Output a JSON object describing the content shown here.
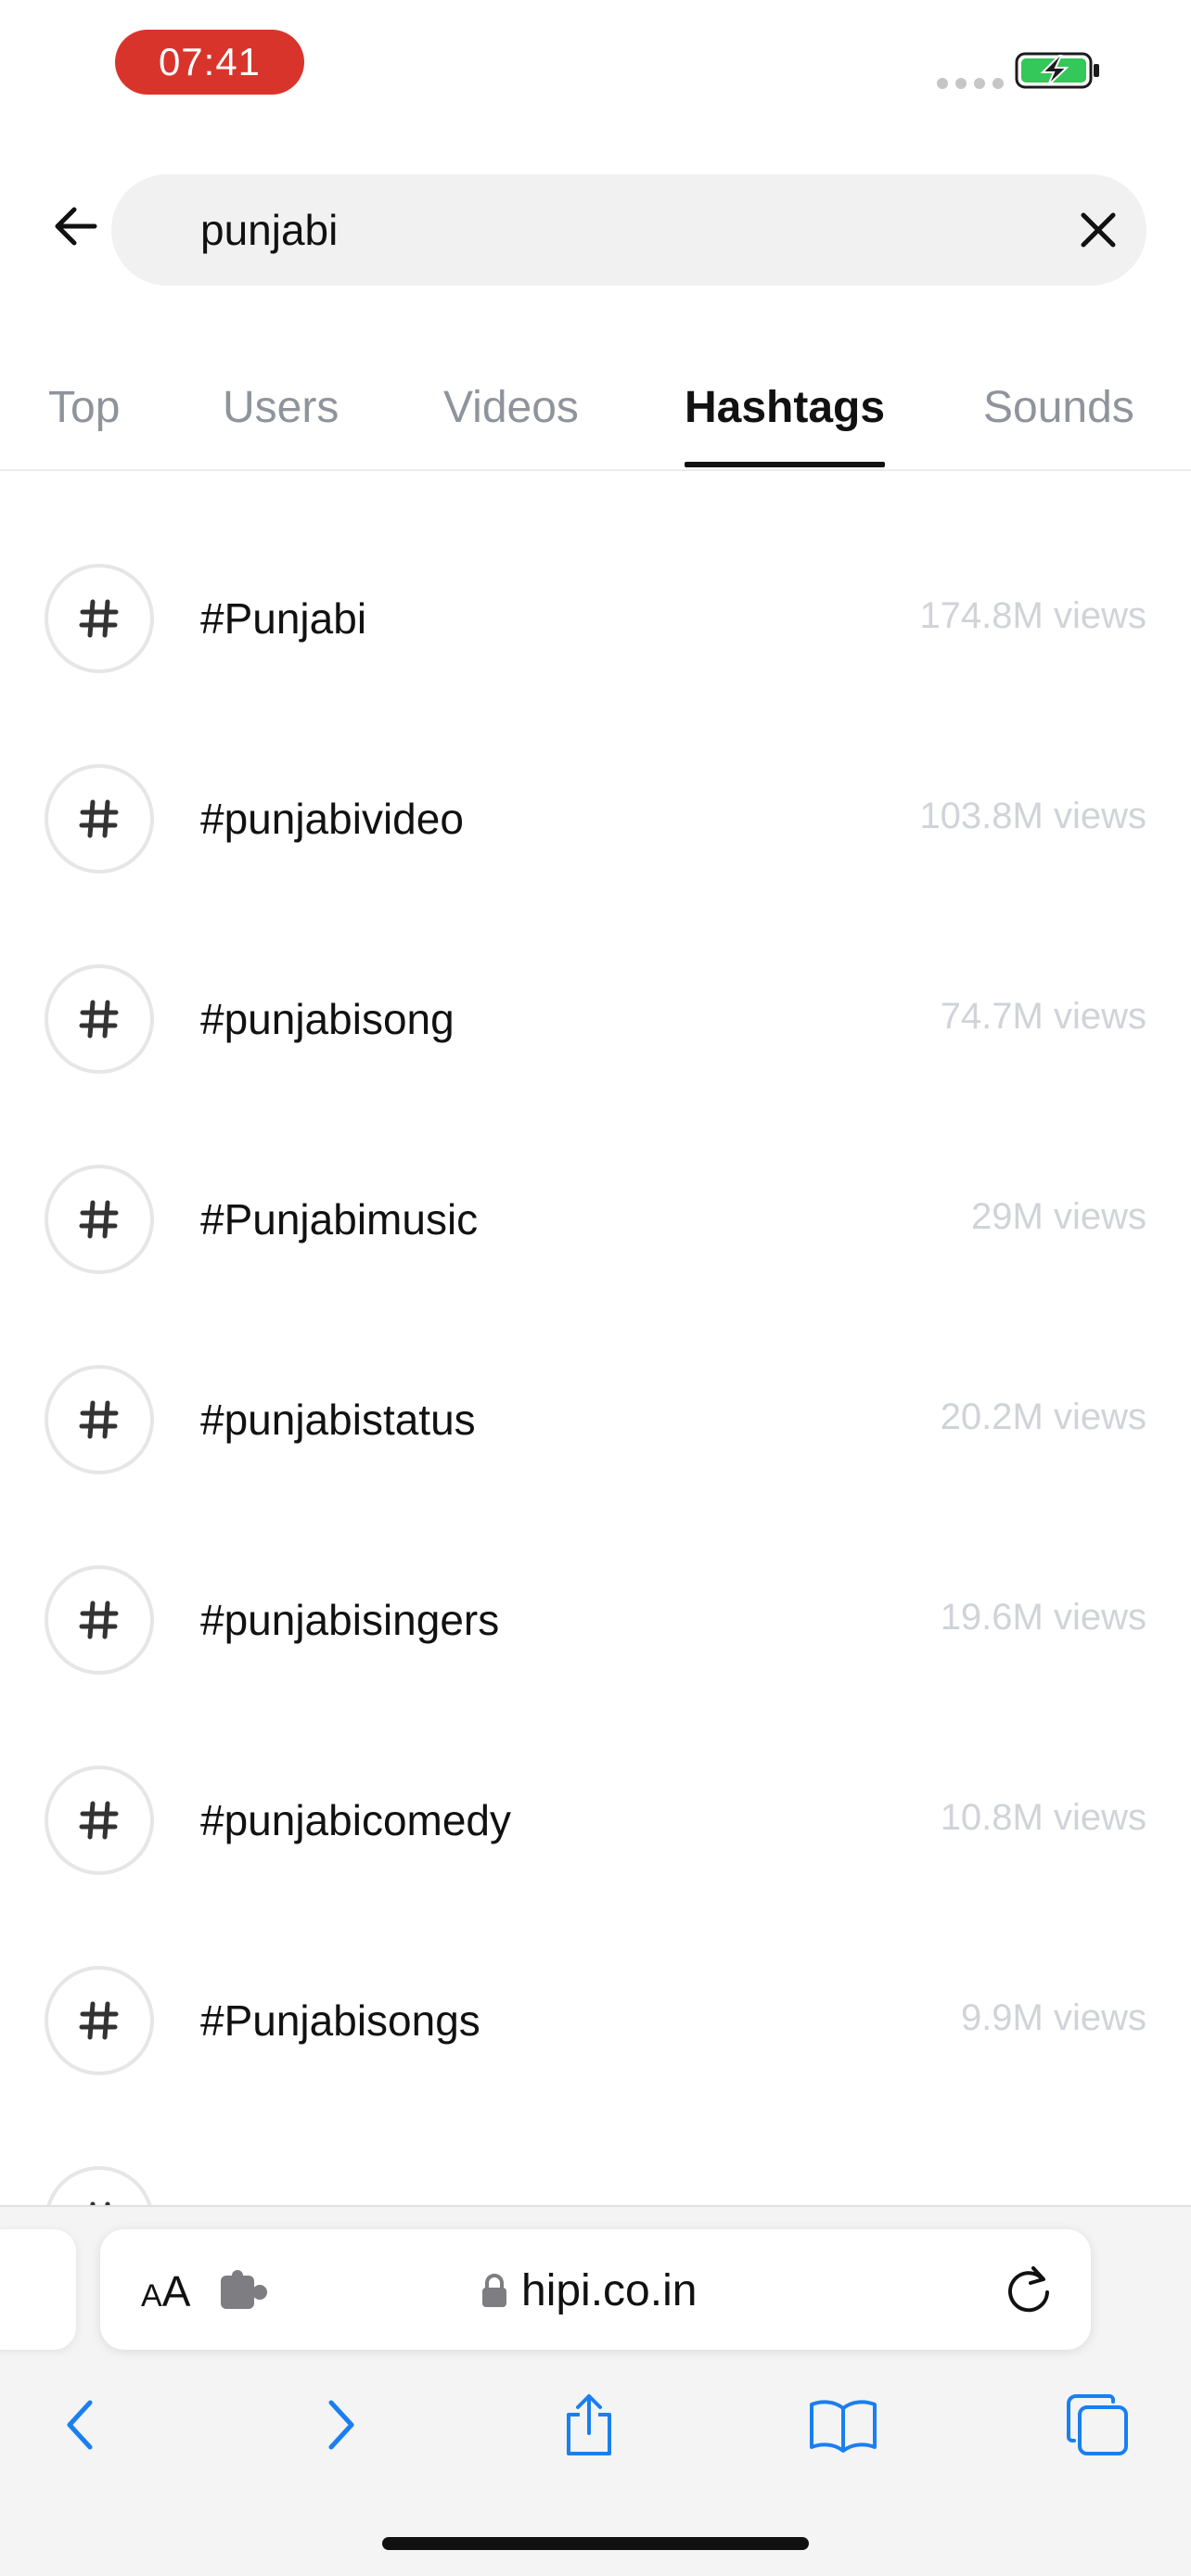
{
  "status_bar": {
    "time": "07:41",
    "battery_state": "charging",
    "battery_color": "#34c759",
    "time_pill_color": "#d9342b"
  },
  "search": {
    "query": "punjabi",
    "back_icon": "arrow-left-icon",
    "clear_icon": "close-icon"
  },
  "tabs": [
    {
      "label": "Top",
      "active": false
    },
    {
      "label": "Users",
      "active": false
    },
    {
      "label": "Videos",
      "active": false
    },
    {
      "label": "Hashtags",
      "active": true
    },
    {
      "label": "Sounds",
      "active": false
    }
  ],
  "hashtags": [
    {
      "name": "#Punjabi",
      "views": "174.8M views"
    },
    {
      "name": "#punjabivideo",
      "views": "103.8M views"
    },
    {
      "name": "#punjabisong",
      "views": "74.7M views"
    },
    {
      "name": "#Punjabimusic",
      "views": "29M views"
    },
    {
      "name": "#punjabistatus",
      "views": "20.2M views"
    },
    {
      "name": "#punjabisingers",
      "views": "19.6M views"
    },
    {
      "name": "#punjabicomedy",
      "views": "10.8M views"
    },
    {
      "name": "#Punjabisongs",
      "views": "9.9M views"
    }
  ],
  "browser": {
    "aa_small": "A",
    "aa_big": "A",
    "url": "hipi.co.in",
    "accent_color": "#1a7ff0",
    "icons": {
      "extension": "puzzle-icon",
      "lock": "lock-icon",
      "reload": "reload-icon",
      "back": "chevron-left-icon",
      "forward": "chevron-right-icon",
      "share": "share-icon",
      "bookmarks": "book-icon",
      "tabs": "tabs-icon"
    }
  }
}
